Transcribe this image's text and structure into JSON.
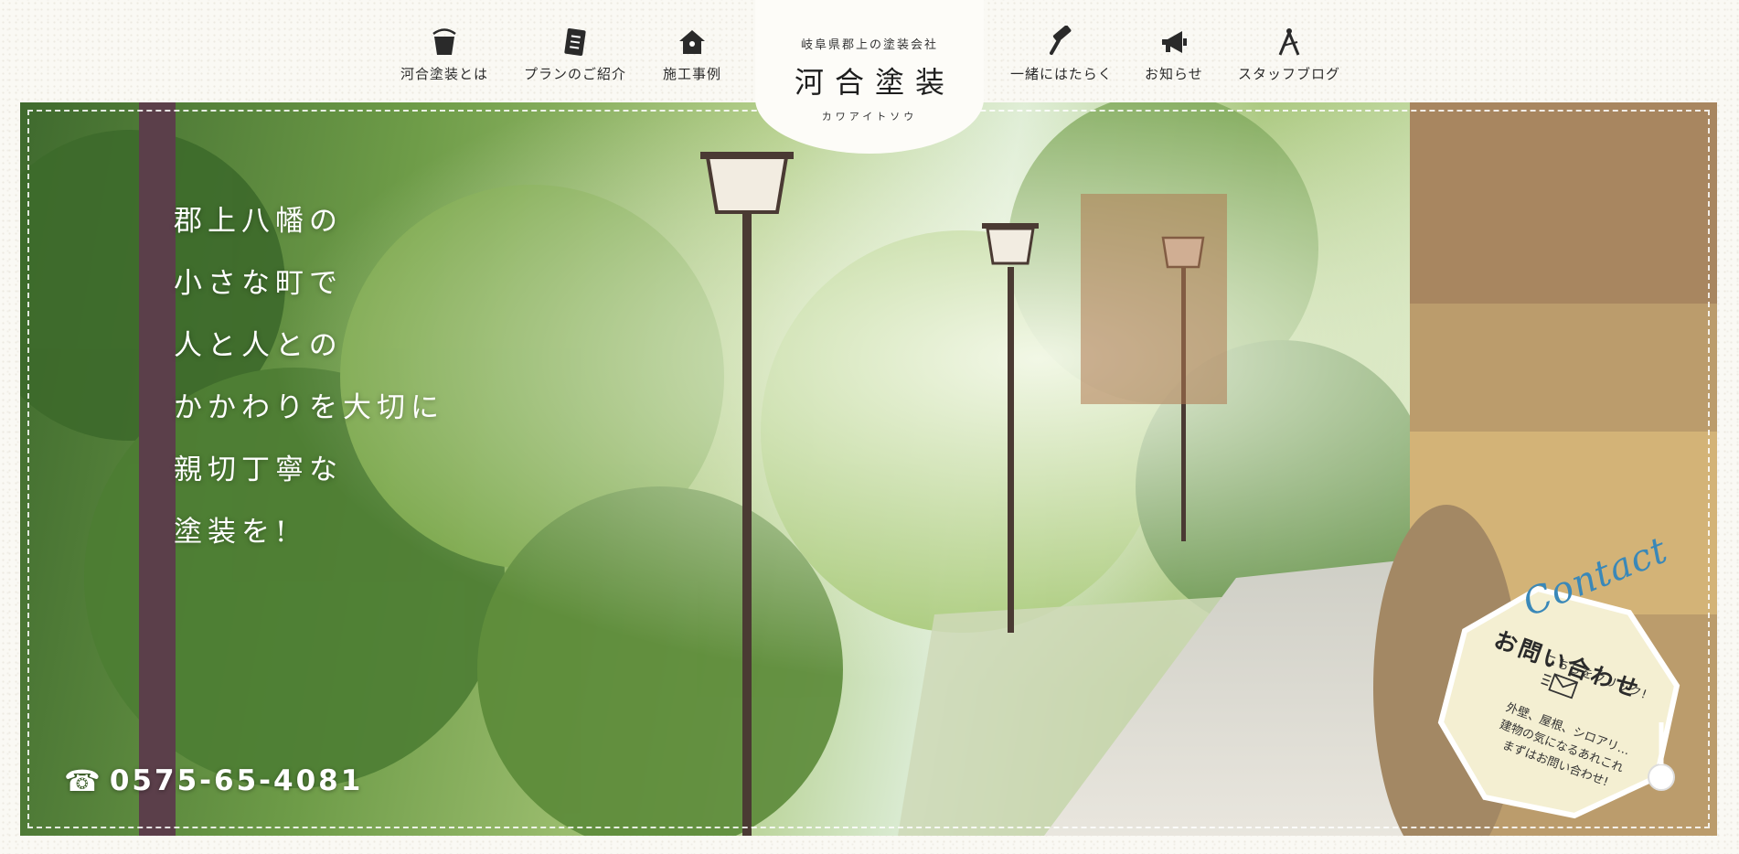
{
  "nav": {
    "left": [
      {
        "label": "河合塗装とは",
        "icon": "paint-bucket-icon"
      },
      {
        "label": "プランのご紹介",
        "icon": "clipboard-list-icon"
      },
      {
        "label": "施工事例",
        "icon": "house-icon"
      }
    ],
    "right": [
      {
        "label": "一緒にはたらく",
        "icon": "paint-roller-icon"
      },
      {
        "label": "お知らせ",
        "icon": "megaphone-icon"
      },
      {
        "label": "スタッフブログ",
        "icon": "compass-pen-icon"
      }
    ]
  },
  "logo": {
    "sub": "岐阜県郡上の塗装会社",
    "main": "河合塗装",
    "kana": "カワアイトソウ"
  },
  "hero": {
    "catch": [
      "郡上八幡の",
      "小さな町で",
      "人と人との",
      "かかわりを大切に",
      "親切丁寧な",
      "塗装を!"
    ],
    "phone": "0575-65-4081",
    "phone_icon": "☎"
  },
  "contact": {
    "script": "Contact",
    "title": "お問い合わせ",
    "click": "こちらをクリック!",
    "desc": [
      "外壁、屋根、シロアリ…",
      "建物の気になるあれこれ",
      "まずはお問い合わせ!"
    ],
    "badge_color": "#f4efd2",
    "script_color": "#3a88b8"
  }
}
